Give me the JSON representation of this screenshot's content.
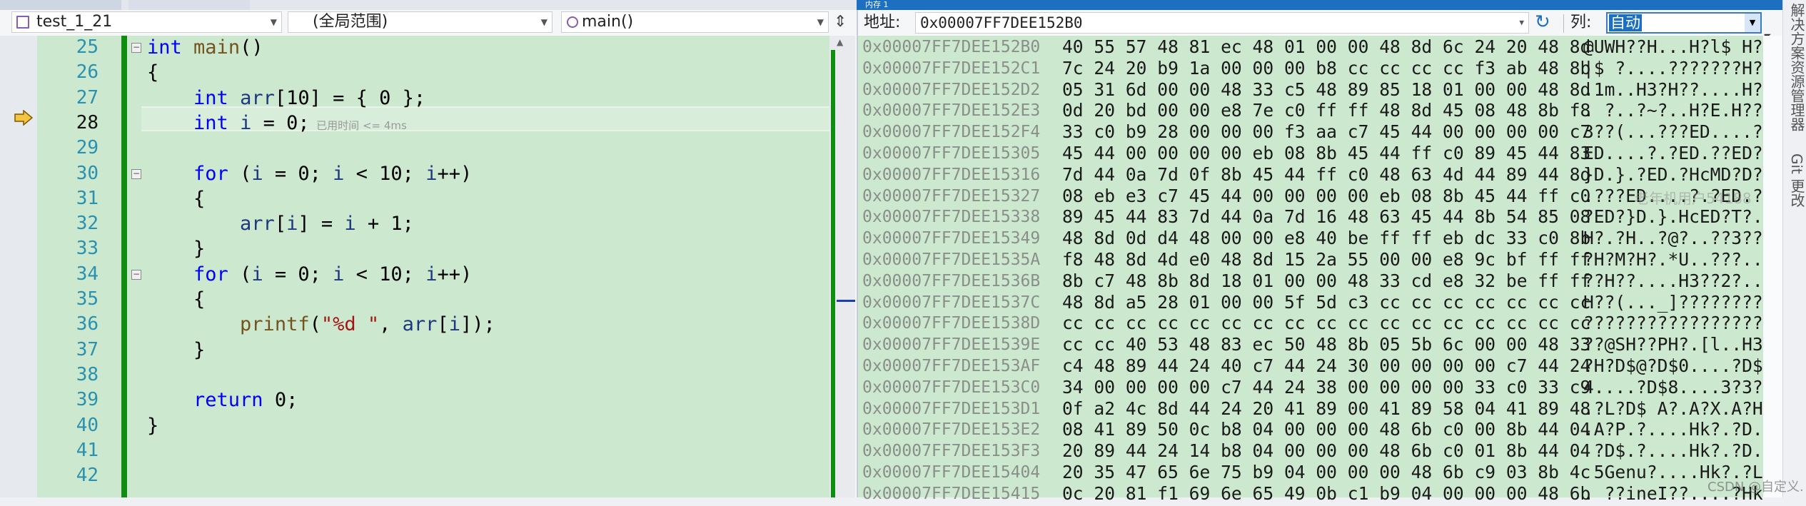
{
  "editor": {
    "dropdowns": {
      "project": "test_1_21",
      "scope": "(全局范围)",
      "member": "main()"
    },
    "current_line": 28,
    "hint": "已用时间 <= 4ms",
    "lines": [
      {
        "n": 25,
        "tokens": [
          [
            "int",
            "kw"
          ],
          [
            " ",
            "pl"
          ],
          [
            "main",
            "fn"
          ],
          [
            "()",
            "pl"
          ]
        ],
        "fold": true
      },
      {
        "n": 26,
        "tokens": [
          [
            "{",
            "pl"
          ]
        ]
      },
      {
        "n": 27,
        "tokens": [
          [
            "    ",
            "pl"
          ],
          [
            "int",
            "kw"
          ],
          [
            " ",
            "pl"
          ],
          [
            "arr",
            "var"
          ],
          [
            "[10] = { 0 };",
            "pl"
          ]
        ]
      },
      {
        "n": 28,
        "tokens": [
          [
            "    ",
            "pl"
          ],
          [
            "int",
            "kw"
          ],
          [
            " ",
            "pl"
          ],
          [
            "i",
            "var"
          ],
          [
            " = 0;",
            "pl"
          ]
        ]
      },
      {
        "n": 29,
        "tokens": []
      },
      {
        "n": 30,
        "tokens": [
          [
            "    ",
            "pl"
          ],
          [
            "for",
            "kw"
          ],
          [
            " (",
            "pl"
          ],
          [
            "i",
            "var"
          ],
          [
            " = 0; ",
            "pl"
          ],
          [
            "i",
            "var"
          ],
          [
            " < 10; ",
            "pl"
          ],
          [
            "i",
            "var"
          ],
          [
            "++)",
            "pl"
          ]
        ],
        "fold": true
      },
      {
        "n": 31,
        "tokens": [
          [
            "    {",
            "pl"
          ]
        ]
      },
      {
        "n": 32,
        "tokens": [
          [
            "        ",
            "pl"
          ],
          [
            "arr",
            "var"
          ],
          [
            "[",
            "pl"
          ],
          [
            "i",
            "var"
          ],
          [
            "] = ",
            "pl"
          ],
          [
            "i",
            "var"
          ],
          [
            " + 1;",
            "pl"
          ]
        ]
      },
      {
        "n": 33,
        "tokens": [
          [
            "    }",
            "pl"
          ]
        ]
      },
      {
        "n": 34,
        "tokens": [
          [
            "    ",
            "pl"
          ],
          [
            "for",
            "kw"
          ],
          [
            " (",
            "pl"
          ],
          [
            "i",
            "var"
          ],
          [
            " = 0; ",
            "pl"
          ],
          [
            "i",
            "var"
          ],
          [
            " < 10; ",
            "pl"
          ],
          [
            "i",
            "var"
          ],
          [
            "++)",
            "pl"
          ]
        ],
        "fold": true
      },
      {
        "n": 35,
        "tokens": [
          [
            "    {",
            "pl"
          ]
        ]
      },
      {
        "n": 36,
        "tokens": [
          [
            "        ",
            "pl"
          ],
          [
            "printf",
            "fn"
          ],
          [
            "(",
            "pl"
          ],
          [
            "\"%d \"",
            "str"
          ],
          [
            ", ",
            "pl"
          ],
          [
            "arr",
            "var"
          ],
          [
            "[",
            "pl"
          ],
          [
            "i",
            "var"
          ],
          [
            "]);",
            "pl"
          ]
        ]
      },
      {
        "n": 37,
        "tokens": [
          [
            "    }",
            "pl"
          ]
        ]
      },
      {
        "n": 38,
        "tokens": []
      },
      {
        "n": 39,
        "tokens": [
          [
            "    ",
            "pl"
          ],
          [
            "return",
            "kw"
          ],
          [
            " 0;",
            "pl"
          ]
        ]
      },
      {
        "n": 40,
        "tokens": [
          [
            "}",
            "pl"
          ]
        ]
      },
      {
        "n": 41,
        "tokens": []
      },
      {
        "n": 42,
        "tokens": []
      }
    ]
  },
  "memory": {
    "title": "内存 1",
    "address_label": "地址:",
    "address_value": "0x00007FF7DEE152B0",
    "columns_label": "列:",
    "columns_value": "自动",
    "rows": [
      {
        "addr": "0x00007FF7DEE152B0",
        "hex": "40 55 57 48 81 ec 48 01 00 00 48 8d 6c 24 20 48 8d",
        "ascii": "@UWH??H...H?l$ H?"
      },
      {
        "addr": "0x00007FF7DEE152C1",
        "hex": "7c 24 20 b9 1a 00 00 00 b8 cc cc cc cc f3 ab 48 8b",
        "ascii": "|$ ?....???????H?"
      },
      {
        "addr": "0x00007FF7DEE152D2",
        "hex": "05 31 6d 00 00 48 33 c5 48 89 85 18 01 00 00 48 8d",
        "ascii": ".1m..H3?H??....H?"
      },
      {
        "addr": "0x00007FF7DEE152E3",
        "hex": "0d 20 bd 00 00 e8 7e c0 ff ff 48 8d 45 08 48 8b f8",
        "ascii": ". ?..?~?..H?E.H??"
      },
      {
        "addr": "0x00007FF7DEE152F4",
        "hex": "33 c0 b9 28 00 00 00 f3 aa c7 45 44 00 00 00 00 c7",
        "ascii": "3??(...???ED....?"
      },
      {
        "addr": "0x00007FF7DEE15305",
        "hex": "45 44 00 00 00 00 eb 08 8b 45 44 ff c0 89 45 44 83",
        "ascii": "ED....?.?ED.??ED?"
      },
      {
        "addr": "0x00007FF7DEE15316",
        "hex": "7d 44 0a 7d 0f 8b 45 44 ff c0 48 63 4d 44 89 44 8d",
        "ascii": "}D.}.?ED.?HcMD?D?"
      },
      {
        "addr": "0x00007FF7DEE15327",
        "hex": "08 eb e3 c7 45 44 00 00 00 00 eb 08 8b 45 44 ff c0",
        "ascii": ".???ED....?.?ED.?"
      },
      {
        "addr": "0x00007FF7DEE15338",
        "hex": "89 45 44 83 7d 44 0a 7d 16 48 63 45 44 8b 54 85 08",
        "ascii": "?ED?}D.}.HcED?T?."
      },
      {
        "addr": "0x00007FF7DEE15349",
        "hex": "48 8d 0d d4 48 00 00 e8 40 be ff ff eb dc 33 c0 8b",
        "ascii": "H?.?H..?@?..??3??"
      },
      {
        "addr": "0x00007FF7DEE1535A",
        "hex": "f8 48 8d 4d e0 48 8d 15 2a 55 00 00 e8 9c bf ff ff",
        "ascii": "?H?M?H?.*U..???.."
      },
      {
        "addr": "0x00007FF7DEE1536B",
        "hex": "8b c7 48 8b 8d 18 01 00 00 48 33 cd e8 32 be ff ff",
        "ascii": "??H??....H3??2?.."
      },
      {
        "addr": "0x00007FF7DEE1537C",
        "hex": "48 8d a5 28 01 00 00 5f 5d c3 cc cc cc cc cc cc cc",
        "ascii": "H??(..._]????????"
      },
      {
        "addr": "0x00007FF7DEE1538D",
        "hex": "cc cc cc cc cc cc cc cc cc cc cc cc cc cc cc cc cc",
        "ascii": "?????????????????"
      },
      {
        "addr": "0x00007FF7DEE1539E",
        "hex": "cc cc 40 53 48 83 ec 50 48 8b 05 5b 6c 00 00 48 33",
        "ascii": "??@SH??PH?.[l..H3"
      },
      {
        "addr": "0x00007FF7DEE153AF",
        "hex": "c4 48 89 44 24 40 c7 44 24 30 00 00 00 00 c7 44 24",
        "ascii": "?H?D$@?D$0....?D$"
      },
      {
        "addr": "0x00007FF7DEE153C0",
        "hex": "34 00 00 00 00 c7 44 24 38 00 00 00 00 33 c0 33 c9",
        "ascii": "4....?D$8....3?3?"
      },
      {
        "addr": "0x00007FF7DEE153D1",
        "hex": "0f a2 4c 8d 44 24 20 41 89 00 41 89 58 04 41 89 48",
        "ascii": ".?L?D$ A?.A?X.A?H"
      },
      {
        "addr": "0x00007FF7DEE153E2",
        "hex": "08 41 89 50 0c b8 04 00 00 00 48 6b c0 00 8b 44 04",
        "ascii": ".A?P.?....Hk?.?D."
      },
      {
        "addr": "0x00007FF7DEE153F3",
        "hex": "20 89 44 24 14 b8 04 00 00 00 48 6b c0 01 8b 44 04",
        "ascii": " ?D$.?....Hk?.?D."
      },
      {
        "addr": "0x00007FF7DEE15404",
        "hex": "20 35 47 65 6e 75 b9 04 00 00 00 48 6b c9 03 8b 4c",
        "ascii": " 5Genu?....Hk?.?L"
      },
      {
        "addr": "0x00007FF7DEE15415",
        "hex": "0c 20 81 f1 69 6e 65 49 0b c1 b9 04 00 00 00 48 6b",
        "ascii": ". ??ineI??....?Hk"
      }
    ]
  },
  "side_rail": {
    "solution_explorer": "解决方案资源管理器",
    "git_changes": "Git 更改"
  },
  "watermarks": {
    "user": "老年机用户54188",
    "csdn": "CSDN @自定义."
  },
  "colors": {
    "code_bg": "#cce8cf",
    "keyword": "#0000ff",
    "accent": "#1d6fc1",
    "change_bar": "#108c10"
  }
}
